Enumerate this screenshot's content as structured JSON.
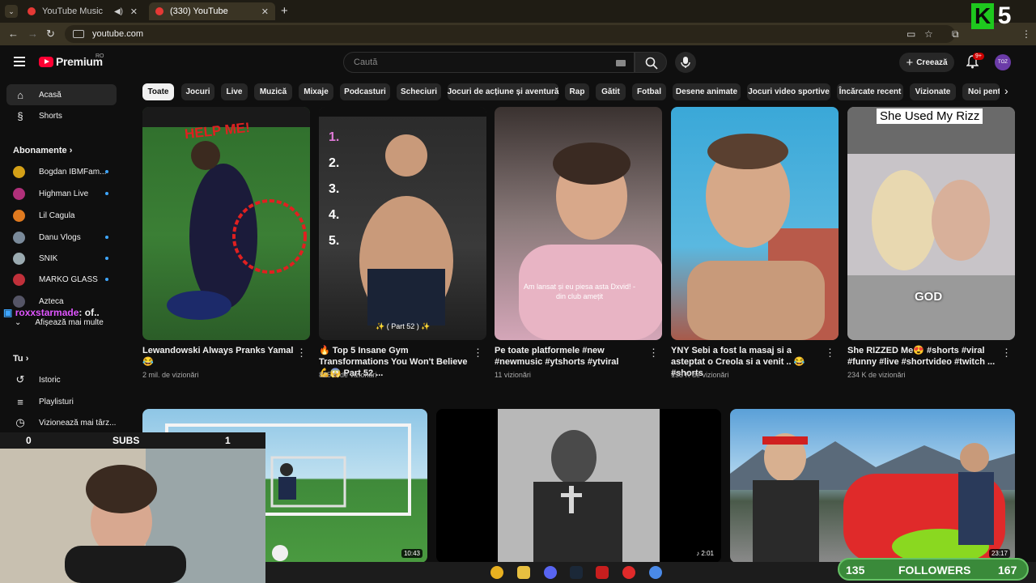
{
  "browser": {
    "tabs": [
      {
        "title": "YouTube Music",
        "active": false
      },
      {
        "title": "(330) YouTube",
        "active": true
      }
    ],
    "url": "youtube.com"
  },
  "header": {
    "logo_text": "Premium",
    "region": "RO",
    "search_placeholder": "Caută",
    "create_label": "Creează",
    "notif_count": "9+",
    "avatar_text": "TOZ"
  },
  "sidebar": {
    "home": "Acasă",
    "shorts": "Shorts",
    "subscriptions_head": "Abonamente",
    "subscriptions": [
      {
        "name": "Bogdan IBMFam...",
        "color": "#d4a017"
      },
      {
        "name": "Highman Live",
        "color": "#b0307a"
      },
      {
        "name": "Lil Cagula",
        "color": "#e07a1f"
      },
      {
        "name": "Danu Vlogs",
        "color": "#7a8a9a"
      },
      {
        "name": "SNIK",
        "color": "#9aaab0"
      },
      {
        "name": "MARKO GLASS",
        "color": "#c0303a"
      },
      {
        "name": "Azteca",
        "color": "#556"
      }
    ],
    "show_more": "Afișează mai multe",
    "you_head": "Tu",
    "you_items": [
      "Istoric",
      "Playlisturi",
      "Vizionează mai târz..."
    ]
  },
  "chips": [
    "Toate",
    "Jocuri",
    "Live",
    "Muzică",
    "Mixaje",
    "Podcasturi",
    "Scheciuri",
    "Jocuri de acțiune și aventură",
    "Rap",
    "Gătit",
    "Fotbal",
    "Desene animate",
    "Jocuri video sportive",
    "Încărcate recent",
    "Vizionate",
    "Noi pentru"
  ],
  "shorts": [
    {
      "title": "Lewandowski Always Pranks Yamal 😂",
      "views": "2 mil. de vizionări",
      "overlay": "HELP ME!"
    },
    {
      "title": "🔥 Top 5 Insane Gym Transformations You Won't Believe 💪😱 Part 52 ...",
      "views": "825 K de vizionări",
      "overlay": "✨ ( Part 52 ) ✨"
    },
    {
      "title": "Pe toate platformele #new #newmusic #ytshorts #ytviral",
      "views": "11 vizionări",
      "overlay": "Am lansat și eu piesa asta Dxvid! - din club amețit"
    },
    {
      "title": "YNY Sebi a fost la masaj si a asteptat o Creola si a venit .. 😂 #shorts",
      "views": "158 K de vizionări",
      "overlay": ""
    },
    {
      "title": "She RIZZED Me😍 #shorts #viral #funny #live #shortvideo #twitch ...",
      "views": "234 K de vizionări",
      "overlay": "She Used My Rizz"
    }
  ],
  "short2_list": [
    "1.",
    "2.",
    "3.",
    "4.",
    "5."
  ],
  "short5_sticker": "GOD",
  "videos": [
    {
      "duration": "10:43"
    },
    {
      "duration": "♪ 2:01"
    },
    {
      "duration": "23:17"
    }
  ],
  "stream": {
    "subs_label": "SUBS",
    "subs_left": "0",
    "subs_right": "1",
    "chat_user": "roxxstarmade",
    "chat_text": ": of..",
    "followers_label": "FOLLOWERS",
    "followers_left": "135",
    "followers_right": "167",
    "k_label": "K",
    "k_num": "5"
  }
}
